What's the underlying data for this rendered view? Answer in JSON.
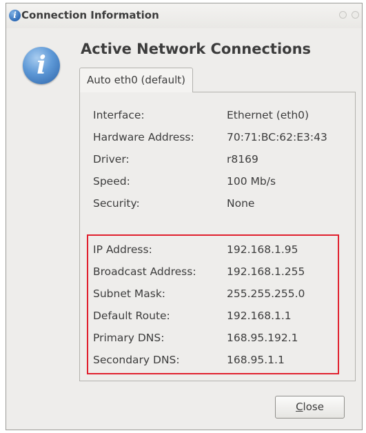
{
  "window": {
    "title": "Connection Information",
    "heading": "Active Network Connections",
    "tab_label": "Auto eth0 (default)"
  },
  "device_info": [
    {
      "label": "Interface:",
      "value": "Ethernet (eth0)"
    },
    {
      "label": "Hardware Address:",
      "value": "70:71:BC:62:E3:43"
    },
    {
      "label": "Driver:",
      "value": "r8169"
    },
    {
      "label": "Speed:",
      "value": "100 Mb/s"
    },
    {
      "label": "Security:",
      "value": "None"
    }
  ],
  "ip_info": [
    {
      "label": "IP Address:",
      "value": "192.168.1.95"
    },
    {
      "label": "Broadcast Address:",
      "value": "192.168.1.255"
    },
    {
      "label": "Subnet Mask:",
      "value": "255.255.255.0"
    },
    {
      "label": "Default Route:",
      "value": "192.168.1.1"
    },
    {
      "label": "Primary DNS:",
      "value": "168.95.192.1"
    },
    {
      "label": "Secondary DNS:",
      "value": "168.95.1.1"
    }
  ],
  "buttons": {
    "close_mnemonic": "C",
    "close_rest": "lose"
  },
  "colors": {
    "highlight_border": "#e01f2d",
    "info_icon": "#2f6bb6"
  },
  "icons": {
    "title_icon": "info-icon",
    "dialog_icon": "info-icon"
  }
}
